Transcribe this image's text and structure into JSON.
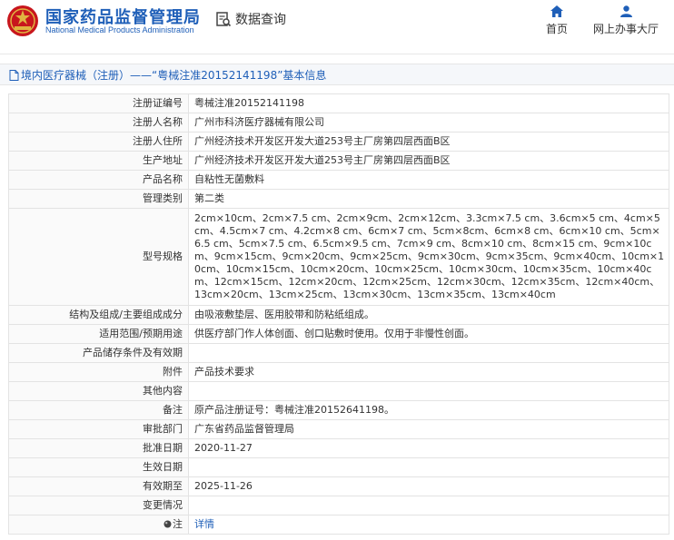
{
  "header": {
    "title": "国家药品监督管理局",
    "subtitle": "National Medical Products Administration",
    "query_label": "数据查询",
    "nav_home": "首页",
    "nav_online": "网上办事大厅"
  },
  "breadcrumb": "境内医疗器械（注册）——“粤械注准20152141198”基本信息",
  "colors": {
    "brand_blue": "#1f5fb8",
    "logo_red": "#c8161d",
    "logo_gold": "#e0b341"
  },
  "rows": [
    {
      "label": "注册证编号",
      "value": "粤械注准20152141198"
    },
    {
      "label": "注册人名称",
      "value": "广州市科济医疗器械有限公司"
    },
    {
      "label": "注册人住所",
      "value": "广州经济技术开发区开发大道253号主厂房第四层西面B区"
    },
    {
      "label": "生产地址",
      "value": "广州经济技术开发区开发大道253号主厂房第四层西面B区"
    },
    {
      "label": "产品名称",
      "value": "自粘性无菌敷料"
    },
    {
      "label": "管理类别",
      "value": "第二类"
    },
    {
      "label": "型号规格",
      "value": "2cm×10cm、2cm×7.5 cm、2cm×9cm、2cm×12cm、3.3cm×7.5 cm、3.6cm×5 cm、4cm×5 cm、4.5cm×7 cm、4.2cm×8 cm、6cm×7 cm、5cm×8cm、6cm×8 cm、6cm×10 cm、5cm×6.5 cm、5cm×7.5 cm、6.5cm×9.5 cm、7cm×9 cm、8cm×10 cm、8cm×15 cm、9cm×10cm、9cm×15cm、9cm×20cm、9cm×25cm、9cm×30cm、9cm×35cm、9cm×40cm、10cm×10cm、10cm×15cm、10cm×20cm、10cm×25cm、10cm×30cm、10cm×35cm、10cm×40cm、12cm×15cm、12cm×20cm、12cm×25cm、12cm×30cm、12cm×35cm、12cm×40cm、13cm×20cm、13cm×25cm、13cm×30cm、13cm×35cm、13cm×40cm"
    },
    {
      "label": "结构及组成/主要组成成分",
      "value": "由吸液敷垫层、医用胶带和防粘纸组成。"
    },
    {
      "label": "适用范围/预期用途",
      "value": "供医疗部门作人体创面、创口贴敷时使用。仅用于非慢性创面。"
    },
    {
      "label": "产品储存条件及有效期",
      "value": ""
    },
    {
      "label": "附件",
      "value": "产品技术要求"
    },
    {
      "label": "其他内容",
      "value": ""
    },
    {
      "label": "备注",
      "value": "原产品注册证号：粤械注准20152641198。"
    },
    {
      "label": "审批部门",
      "value": "广东省药品监督管理局"
    },
    {
      "label": "批准日期",
      "value": "2020-11-27"
    },
    {
      "label": "生效日期",
      "value": ""
    },
    {
      "label": "有效期至",
      "value": "2025-11-26"
    },
    {
      "label": "变更情况",
      "value": ""
    },
    {
      "label": "注",
      "value": "详情"
    }
  ]
}
